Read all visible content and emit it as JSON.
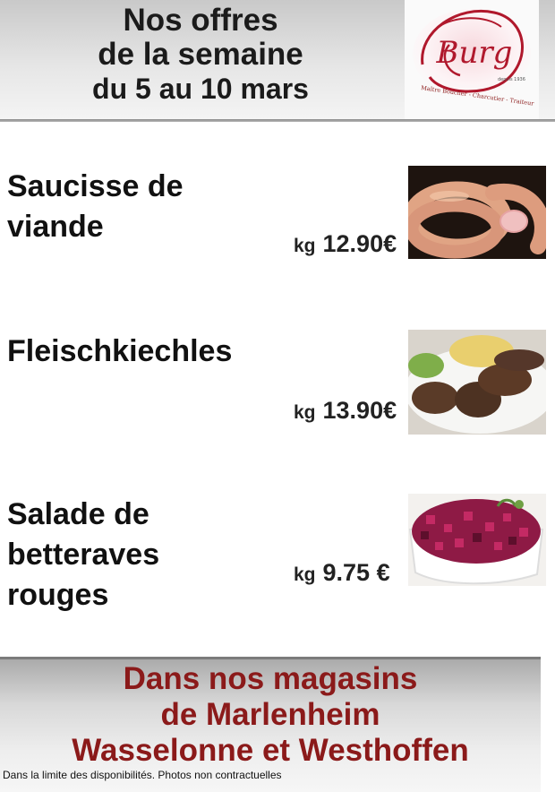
{
  "header": {
    "title_line1": "Nos offres",
    "title_line2": "de la semaine",
    "title_line3": "du 5 au 10 mars",
    "logo": {
      "name": "Burg",
      "tagline": "Maître Boucher - Charcutier - Traiteur",
      "since": "depuis 1936"
    }
  },
  "products": [
    {
      "name_line1": "Saucisse de",
      "name_line2": "viande",
      "name_line3": "",
      "unit": "kg",
      "price": "12.90€",
      "photo": "saucisse-photo"
    },
    {
      "name_line1": "Fleischkiechles",
      "name_line2": "",
      "name_line3": "",
      "unit": "kg",
      "price": "13.90€",
      "photo": "fleischkiechles-photo"
    },
    {
      "name_line1": "Salade de",
      "name_line2": "betteraves",
      "name_line3": "rouges",
      "unit": "kg",
      "price": "9.75 €",
      "photo": "betteraves-photo"
    }
  ],
  "footer": {
    "line1": "Dans nos magasins",
    "line2": "de Marlenheim",
    "line3": "Wasselonne et Westhoffen",
    "disclaimer": "Dans la limite des disponibilités. Photos non contractuelles"
  },
  "colors": {
    "footer_text": "#8b1a1a",
    "logo_red": "#b0182c"
  }
}
